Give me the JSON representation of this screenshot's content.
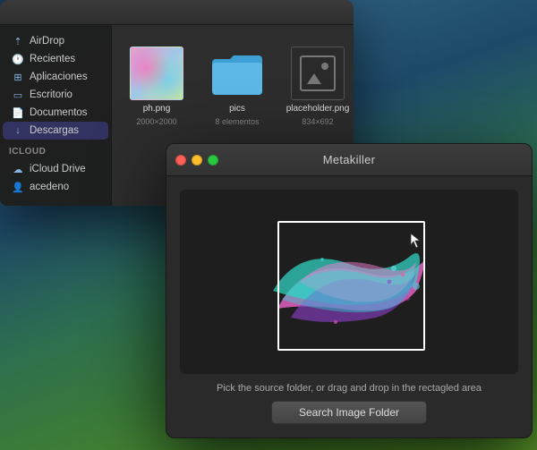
{
  "desktop": {
    "bg_description": "macOS Big Sur mountain landscape"
  },
  "finder": {
    "sidebar": {
      "items": [
        {
          "id": "airdrop",
          "label": "AirDrop",
          "icon": "airdrop"
        },
        {
          "id": "recientes",
          "label": "Recientes",
          "icon": "clock"
        },
        {
          "id": "aplicaciones",
          "label": "Aplicaciones",
          "icon": "grid"
        },
        {
          "id": "escritorio",
          "label": "Escritorio",
          "icon": "desktop"
        },
        {
          "id": "documentos",
          "label": "Documentos",
          "icon": "doc"
        },
        {
          "id": "descargas",
          "label": "Descargas",
          "icon": "download",
          "active": true
        }
      ],
      "icloud_label": "iCloud",
      "icloud_items": [
        {
          "id": "icloud-drive",
          "label": "iCloud Drive",
          "icon": "cloud"
        }
      ],
      "other_items": [
        {
          "id": "acedeno",
          "label": "acedeno",
          "icon": "person"
        }
      ]
    },
    "files": [
      {
        "name": "ph.png",
        "meta": "2000×2000",
        "type": "image"
      },
      {
        "name": "pics",
        "meta": "8 elementos",
        "type": "folder"
      },
      {
        "name": "placeholder.png",
        "meta": "834×692",
        "type": "placeholder"
      }
    ]
  },
  "metakiller": {
    "title": "Metakiller",
    "instruction": "Pick the source folder, or drag and drop in the rectagled area",
    "search_button": "Search Image Folder",
    "controls": {
      "close": "close",
      "minimize": "minimize",
      "maximize": "maximize"
    }
  }
}
